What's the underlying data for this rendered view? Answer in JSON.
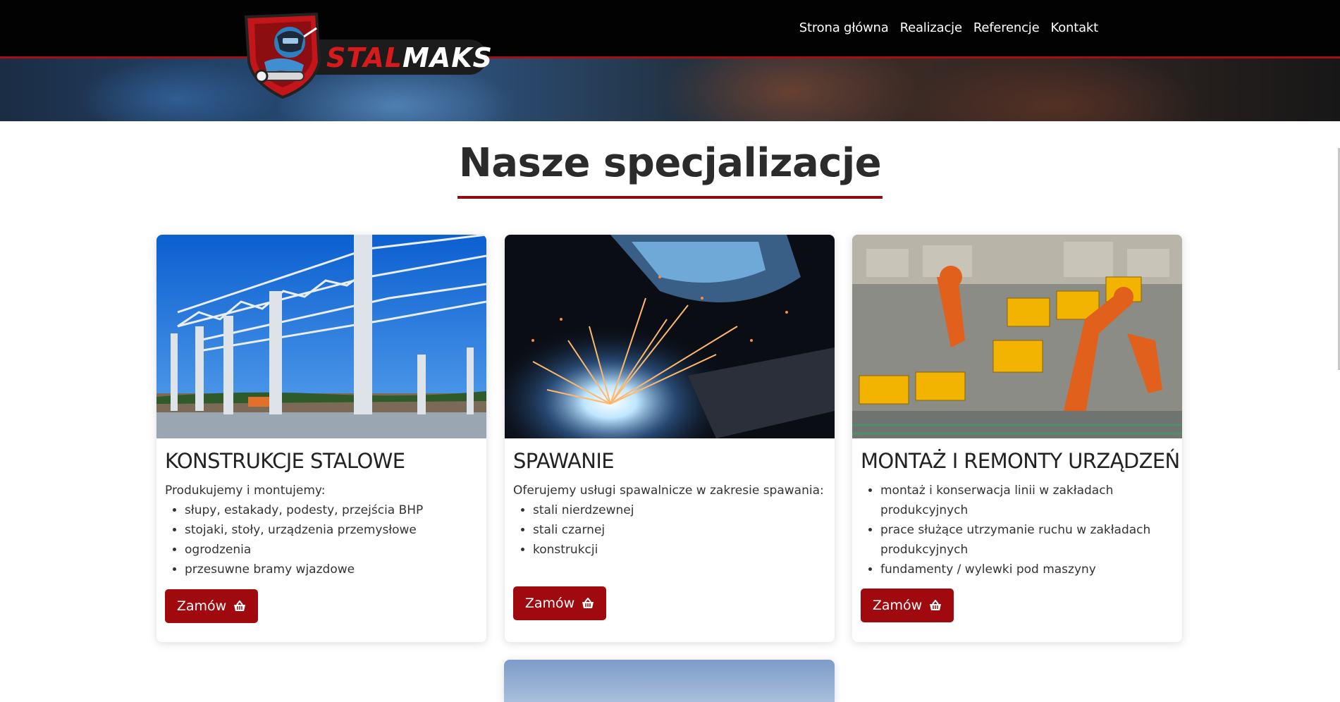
{
  "header": {
    "logo": {
      "part1": "STAL",
      "part2": "MAKS",
      "colors": {
        "part1": "#d91a1d",
        "part2": "#ffffff"
      }
    },
    "nav": [
      "Strona główna",
      "Realizacje",
      "Referencje",
      "Kontakt"
    ],
    "accent_color": "#a30f12"
  },
  "main": {
    "title": "Nasze specjalizacje",
    "cards": [
      {
        "image": "steel-structure-photo",
        "title": "KONSTRUKCJE STALOWE",
        "intro": "Produkujemy i montujemy:",
        "items": [
          "słupy, estakady, podesty, przejścia BHP",
          "stojaki, stoły, urządzenia przemysłowe",
          "ogrodzenia",
          "przesuwne bramy wjazdowe"
        ],
        "button": "Zamów",
        "button_icon": "basket-icon"
      },
      {
        "image": "welding-sparks-photo",
        "title": "SPAWANIE",
        "intro": "Oferujemy usługi spawalnicze w zakresie spawania:",
        "items": [
          "stali nierdzewnej",
          "stali czarnej",
          "konstrukcji"
        ],
        "button": "Zamów",
        "button_icon": "basket-icon"
      },
      {
        "image": "industrial-robots-photo",
        "title": "MONTAŻ I REMONTY URZĄDZEŃ",
        "items": [
          "montaż i konserwacja linii w zakładach produkcyjnych",
          "prace służące utrzymanie ruchu w zakładach produkcyjnych",
          "fundamenty / wylewki pod maszyny"
        ],
        "button": "Zamów",
        "button_icon": "basket-icon"
      }
    ],
    "button_color": "#a0090d"
  }
}
